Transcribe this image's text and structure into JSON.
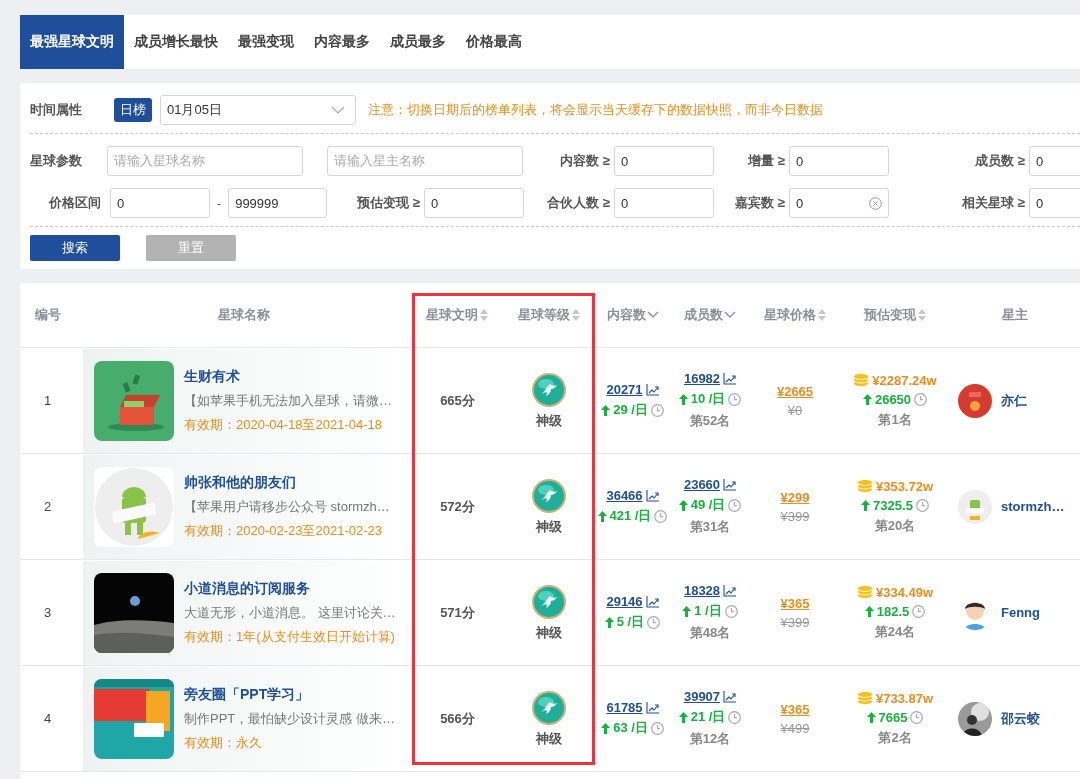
{
  "tabs": [
    {
      "label": "最强星球文明",
      "selected": true
    },
    {
      "label": "成员增长最快",
      "selected": false
    },
    {
      "label": "最强变现",
      "selected": false
    },
    {
      "label": "内容最多",
      "selected": false
    },
    {
      "label": "成员最多",
      "selected": false
    },
    {
      "label": "价格最高",
      "selected": false
    }
  ],
  "filters": {
    "time": {
      "label": "时间属性",
      "badge": "日榜",
      "date": "01月05日",
      "notice": "注意：切换日期后的榜单列表，将会显示当天缓存下的数据快照，而非今日数据"
    },
    "rows": [
      [
        {
          "kind": "heading",
          "label": "星球参数"
        },
        {
          "kind": "field",
          "placeholder": "请输入星球名称"
        },
        {
          "kind": "field",
          "placeholder": "请输入星主名称"
        },
        {
          "kind": "field",
          "label": "内容数 ≥",
          "value": "0"
        },
        {
          "kind": "field",
          "label": "增量 ≥",
          "value": "0"
        },
        {
          "kind": "field",
          "label": "成员数 ≥",
          "value": "0"
        }
      ],
      [
        {
          "kind": "heading",
          "label": "价格区间"
        },
        {
          "kind": "range",
          "from": "0",
          "separator": "-",
          "to": "999999"
        },
        {
          "kind": "field",
          "label": "预估变现 ≥",
          "value": "0"
        },
        {
          "kind": "field",
          "label": "合伙人数 ≥",
          "value": "0"
        },
        {
          "kind": "field",
          "label": "嘉宾数 ≥",
          "value": "0",
          "clearable": true
        },
        {
          "kind": "field",
          "label": "相关星球 ≥",
          "value": "0"
        }
      ]
    ]
  },
  "buttons": [
    {
      "label": "搜索",
      "kind": "primary"
    },
    {
      "label": "重置",
      "kind": "secondary"
    }
  ],
  "table": {
    "columns": [
      {
        "label": "编号",
        "kind": "plain",
        "highlighted": false
      },
      {
        "label": "星球名称",
        "kind": "plain",
        "highlighted": false
      },
      {
        "label": "星球文明",
        "kind": "sortable",
        "highlighted": true
      },
      {
        "label": "星球等级",
        "kind": "sortable",
        "highlighted": true
      },
      {
        "label": "内容数",
        "kind": "dropdown",
        "highlighted": false
      },
      {
        "label": "成员数",
        "kind": "dropdown",
        "highlighted": false
      },
      {
        "label": "星球价格",
        "kind": "sortable",
        "highlighted": false
      },
      {
        "label": "预估变现",
        "kind": "sortable",
        "highlighted": false
      },
      {
        "label": "星主",
        "kind": "plain",
        "highlighted": false
      }
    ],
    "rows": [
      {
        "no": "1",
        "name": "生财有术",
        "desc": "【如苹果手机无法加入星球，请微…",
        "validity": "有效期：2020-04-18至2021-04-18",
        "score": "665分",
        "level": "神级",
        "content": {
          "count": "20271",
          "daily": "29 /日"
        },
        "members": {
          "count": "16982",
          "daily": "10 /日",
          "rank": "第52名"
        },
        "price": {
          "current": "¥2665",
          "original": "¥0"
        },
        "revenue": {
          "amount": "¥2287.24w",
          "daily": "26650",
          "rank": "第1名"
        },
        "owner": "亦仁"
      },
      {
        "no": "2",
        "name": "帅张和他的朋友们",
        "desc": "【苹果用户请移步公众号 stormzh…",
        "validity": "有效期：2020-02-23至2021-02-23",
        "score": "572分",
        "level": "神级",
        "content": {
          "count": "36466",
          "daily": "421 /日"
        },
        "members": {
          "count": "23660",
          "daily": "49 /日",
          "rank": "第31名"
        },
        "price": {
          "current": "¥299",
          "original": "¥399"
        },
        "revenue": {
          "amount": "¥353.72w",
          "daily": "7325.5",
          "rank": "第20名"
        },
        "owner": "stormzh…"
      },
      {
        "no": "3",
        "name": "小道消息的订阅服务",
        "desc": "大道无形，小道消息。 这里讨论关…",
        "validity": "有效期：1年(从支付生效日开始计算)",
        "score": "571分",
        "level": "神级",
        "content": {
          "count": "29146",
          "daily": "5 /日"
        },
        "members": {
          "count": "18328",
          "daily": "1 /日",
          "rank": "第48名"
        },
        "price": {
          "current": "¥365",
          "original": "¥399"
        },
        "revenue": {
          "amount": "¥334.49w",
          "daily": "182.5",
          "rank": "第24名"
        },
        "owner": "Fenng"
      },
      {
        "no": "4",
        "name": "旁友圈「PPT学习」",
        "desc": "制作PPT，最怕缺少设计灵感 做来…",
        "validity": "有效期：永久",
        "score": "566分",
        "level": "神级",
        "content": {
          "count": "61785",
          "daily": "63 /日"
        },
        "members": {
          "count": "39907",
          "daily": "21 /日",
          "rank": "第12名"
        },
        "price": {
          "current": "¥365",
          "original": "¥499"
        },
        "revenue": {
          "amount": "¥733.87w",
          "daily": "7665",
          "rank": "第2名"
        },
        "owner": "邵云蛟"
      }
    ]
  }
}
